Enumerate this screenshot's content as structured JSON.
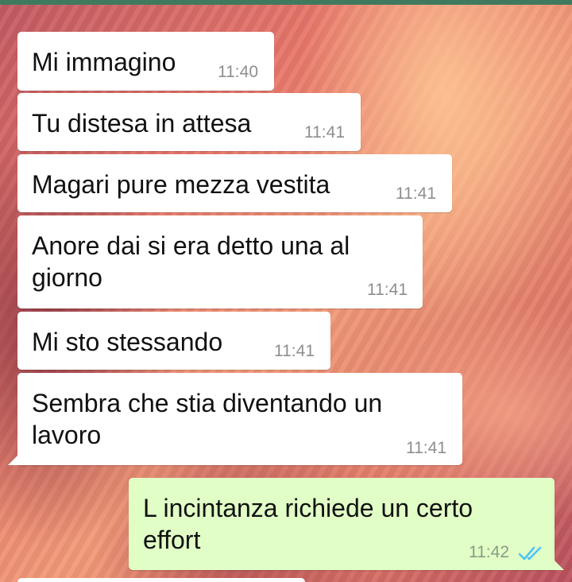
{
  "conversation": {
    "messages": [
      {
        "text": "Mi immagino",
        "time": "11:40",
        "direction": "incoming"
      },
      {
        "text": "Tu distesa in attesa",
        "time": "11:41",
        "direction": "incoming"
      },
      {
        "text": "Magari pure mezza vestita",
        "time": "11:41",
        "direction": "incoming"
      },
      {
        "text": "Anore dai si era detto una al\ngiorno",
        "time": "11:41",
        "direction": "incoming"
      },
      {
        "text": "Mi sto stessando",
        "time": "11:41",
        "direction": "incoming"
      },
      {
        "text": "Sembra che stia diventando un\nlavoro",
        "time": "11:41",
        "direction": "incoming"
      },
      {
        "text": "L incintanza richiede un certo\neffort",
        "time": "11:42",
        "direction": "outgoing",
        "status": "read"
      }
    ]
  },
  "colors": {
    "top_bar": "#3f7a5e",
    "incoming_bubble": "#ffffff",
    "outgoing_bubble": "#e1fec6",
    "read_ticks": "#4fc3f7"
  },
  "icons": {
    "read_receipt": "double-check-icon"
  }
}
